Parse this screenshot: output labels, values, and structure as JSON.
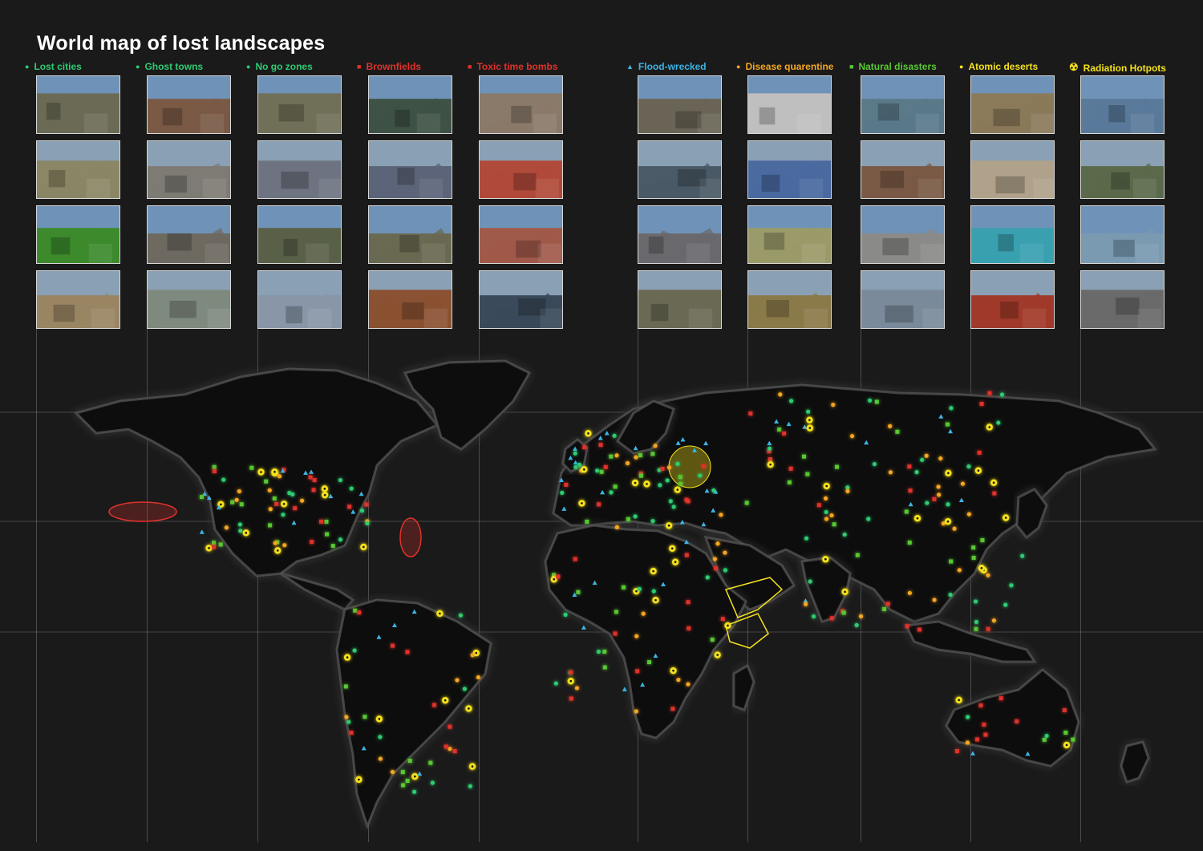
{
  "title": "World map of lost landscapes",
  "categories": [
    {
      "label": "Lost cities",
      "color": "#2ecc71",
      "marker": "circle",
      "palette": [
        "#6b6b55",
        "#8a8666",
        "#3c8a2c",
        "#9a8563"
      ]
    },
    {
      "label": "Ghost towns",
      "color": "#2ecc71",
      "marker": "circle",
      "palette": [
        "#7a5a45",
        "#7d7b74",
        "#6e6a60",
        "#7f8a7f"
      ]
    },
    {
      "label": "No go zones",
      "color": "#2ecc71",
      "marker": "circle",
      "palette": [
        "#707058",
        "#6d7380",
        "#5a6048",
        "#8896a8"
      ]
    },
    {
      "label": "Brownfields",
      "color": "#e0322c",
      "marker": "square",
      "palette": [
        "#3f5246",
        "#5b6478",
        "#6a6a52",
        "#8a5232"
      ]
    },
    {
      "label": "Toxic time bombs",
      "color": "#e0322c",
      "marker": "square",
      "palette": [
        "#8a7a6a",
        "#b04a3a",
        "#a05a4a",
        "#3a4a5a"
      ]
    },
    {
      "label": "Flood-wrecked",
      "color": "#3cb4e6",
      "marker": "triangle",
      "palette": [
        "#6a6456",
        "#4a5a66",
        "#6a6a6e",
        "#6a6a54"
      ]
    },
    {
      "label": "Disease quarentine",
      "color": "#f5a623",
      "marker": "circle",
      "palette": [
        "#bfbfbf",
        "#4a6aa0",
        "#9a9a6a",
        "#8a7a4a"
      ]
    },
    {
      "label": "Natural disasters",
      "color": "#59c832",
      "marker": "square",
      "palette": [
        "#5a7a8a",
        "#7a5a45",
        "#8a8a88",
        "#7a8a9a"
      ]
    },
    {
      "label": "Atomic deserts",
      "color": "#f5e11e",
      "marker": "circle",
      "palette": [
        "#8a7a5a",
        "#b0a28a",
        "#3aa0b0",
        "#a03a2a"
      ]
    },
    {
      "label": "Radiation Hotpots",
      "color": "#f5e11e",
      "marker": "radiation",
      "palette": [
        "#5a7a9a",
        "#5a6a4a",
        "#7a9ab0",
        "#6a6a6a"
      ]
    }
  ],
  "colors": {
    "background": "#1a1a1a",
    "land": "#0c0c0c",
    "land_glow": "#5a5a5a",
    "grid": "#9a9a9a",
    "text": "#ffffff"
  },
  "icons": {
    "circle_marker": "circle-icon",
    "square_marker": "square-icon",
    "triangle_marker": "triangle-icon",
    "radiation_marker": "radiation-icon"
  }
}
